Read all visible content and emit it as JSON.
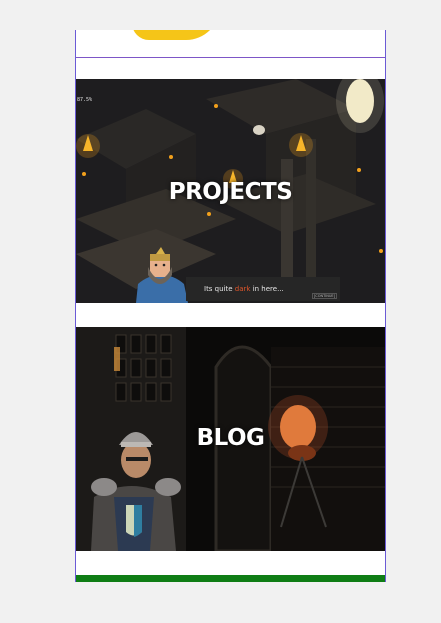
{
  "cards": {
    "projects": {
      "title": "PROJECTS",
      "hud_zoom": "87.5%",
      "dialog": {
        "text_before": "Its quite ",
        "text_accent": "dark",
        "text_after": " in here...",
        "button": "[CONTINUE]"
      }
    },
    "blog": {
      "title": "BLOG"
    }
  },
  "colors": {
    "logo": "#f5c518",
    "footer_bar": "#0f7d15",
    "dialog_accent": "#e0562a",
    "frame_border": "#6b5bd6"
  }
}
